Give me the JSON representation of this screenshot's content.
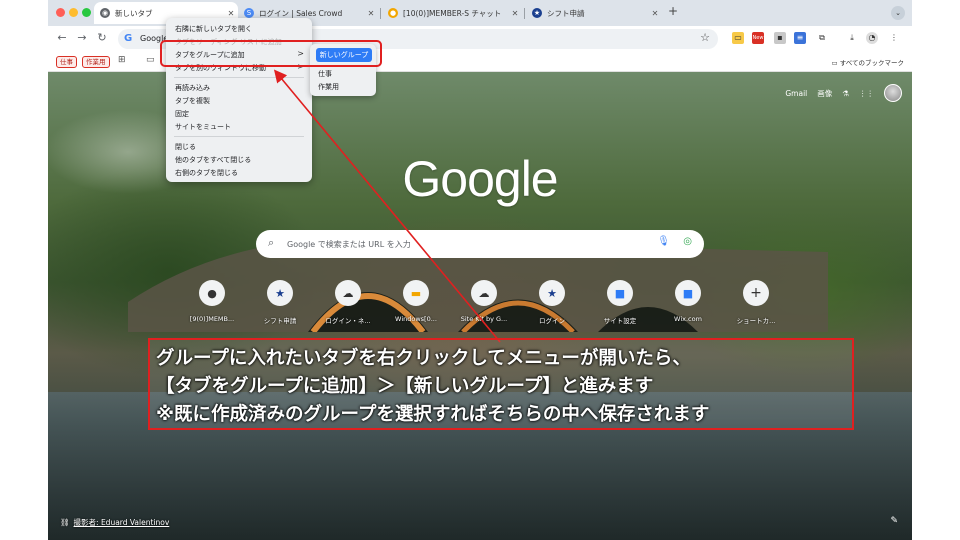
{
  "tabs": [
    {
      "label": "新しいタブ",
      "icon": "chrome-icon",
      "active": true
    },
    {
      "label": "ログイン | Sales Crowd",
      "icon": "salescrowd-icon"
    },
    {
      "label": "[10(0)]MEMBER-S チャット",
      "icon": "chat-icon"
    },
    {
      "label": "シフト申請",
      "icon": "star-icon"
    }
  ],
  "toolbar": {
    "url_text": "Google",
    "ext_new_badge": "New"
  },
  "bookmarks": {
    "chip1": "仕事",
    "chip2": "作業用",
    "all_bookmarks": "すべてのブックマーク"
  },
  "google": {
    "gmail": "Gmail",
    "images": "画像",
    "logo": "Google",
    "search_placeholder": "Google で検索または URL を入力"
  },
  "shortcuts": [
    {
      "label": "[9(0)]MEMB..."
    },
    {
      "label": "シフト申請"
    },
    {
      "label": "ログイン・ネ..."
    },
    {
      "label": "Windows[0..."
    },
    {
      "label": "Site Kit by G..."
    },
    {
      "label": "ログイン"
    },
    {
      "label": "サイト設定"
    },
    {
      "label": "Wix.com"
    },
    {
      "label": "ショートカ..."
    }
  ],
  "credit": "撮影者: Eduard Valentinov",
  "context_menu": {
    "items": [
      "右隣に新しいタブを開く",
      "タブをリーディング リストに追加",
      "タブをグループに追加",
      "タブを別のウィンドウに移動",
      "再読み込み",
      "タブを複製",
      "固定",
      "サイトをミュート",
      "閉じる",
      "他のタブをすべて閉じる",
      "右側のタブを閉じる"
    ],
    "arrow": ">"
  },
  "submenu": {
    "new_group": "新しいグループ",
    "items": [
      "仕事",
      "作業用"
    ]
  },
  "annotation": {
    "line1": "グループに入れたいタブを右クリックしてメニューが開いたら、",
    "line2": "【タブをグループに追加】＞【新しいグループ】と進みます",
    "line3": "※既に作成済みのグループを選択すればそちらの中へ保存されます"
  },
  "colors": {
    "annotation_red": "#e02020",
    "submenu_blue": "#2e7cf6",
    "tabstrip": "#dde3ea"
  }
}
